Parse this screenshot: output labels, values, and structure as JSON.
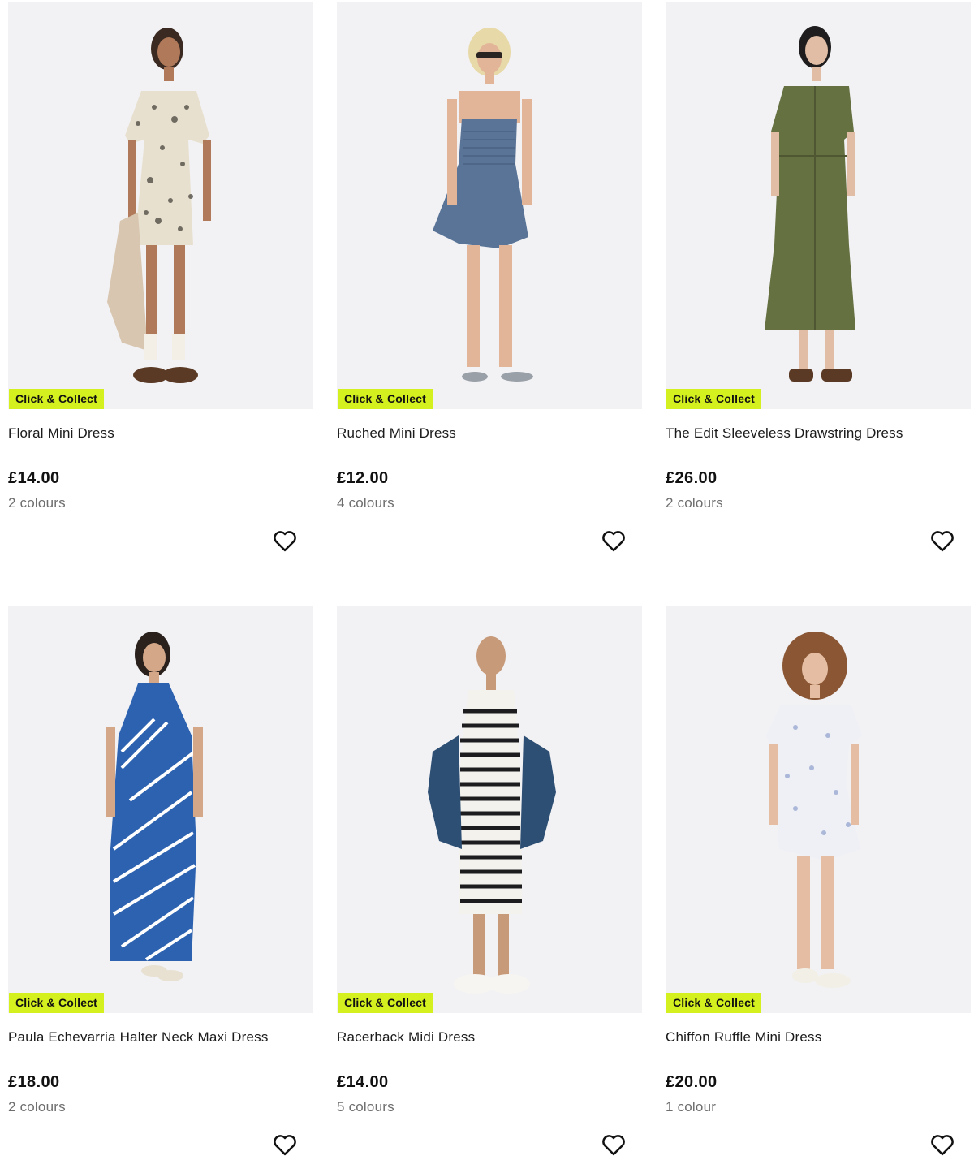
{
  "products": [
    {
      "title": "Floral Mini Dress",
      "price": "£14.00",
      "colours": "2 colours",
      "badge": "Click & Collect",
      "dress_color": "#e8e0cf",
      "pattern": "floral-dark"
    },
    {
      "title": "Ruched Mini Dress",
      "price": "£12.00",
      "colours": "4 colours",
      "badge": "Click & Collect",
      "dress_color": "#5a7497",
      "pattern": "plain"
    },
    {
      "title": "The Edit Sleeveless Drawstring Dress",
      "price": "£26.00",
      "colours": "2 colours",
      "badge": "Click & Collect",
      "dress_color": "#667142",
      "pattern": "plain"
    },
    {
      "title": "Paula Echevarria Halter Neck Maxi Dress",
      "price": "£18.00",
      "colours": "2 colours",
      "badge": "Click & Collect",
      "dress_color": "#2d62b0",
      "pattern": "stripes-diagonal"
    },
    {
      "title": "Racerback Midi Dress",
      "price": "£14.00",
      "colours": "5 colours",
      "badge": "Click & Collect",
      "dress_color": "#f4f2ec",
      "pattern": "stripes-horizontal"
    },
    {
      "title": "Chiffon Ruffle Mini Dress",
      "price": "£20.00",
      "colours": "1 colour",
      "badge": "Click & Collect",
      "dress_color": "#eef0f6",
      "pattern": "floral-light"
    }
  ],
  "icons": {
    "wishlist": "heart-outline-icon"
  },
  "colors": {
    "badge_bg": "#d4f01e",
    "image_bg": "#f2f2f4",
    "text": "#1b1b1b",
    "muted": "#6e6e6e"
  }
}
